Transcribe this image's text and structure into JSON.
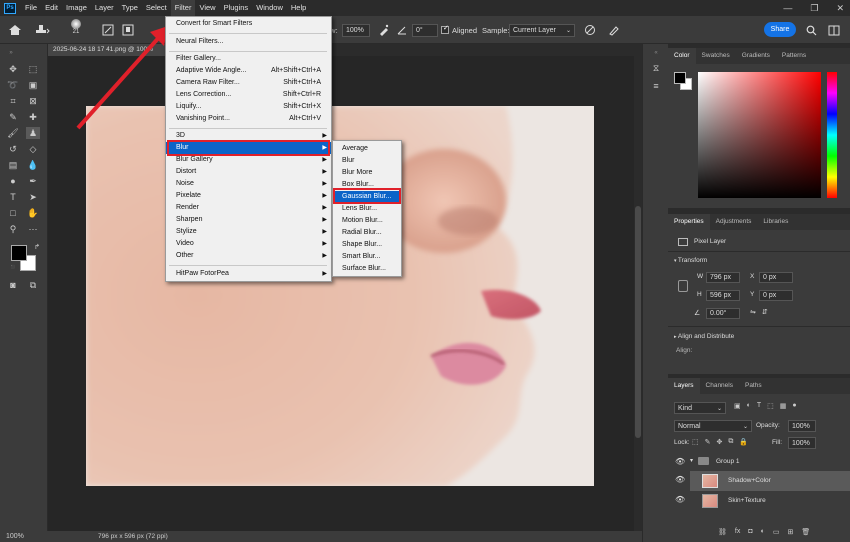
{
  "menubar": {
    "logo": "Ps",
    "items": [
      "File",
      "Edit",
      "Image",
      "Layer",
      "Type",
      "Select",
      "Filter",
      "View",
      "Plugins",
      "Window",
      "Help"
    ],
    "active_index": 6,
    "window_controls": [
      "—",
      "❐",
      "✕"
    ]
  },
  "options": {
    "brush_size": "21",
    "mode_label": "ow:",
    "flow_value": "100%",
    "angle_value": "0°",
    "aligned_label": "Aligned",
    "sample_label": "Sample:",
    "sample_value": "Current Layer",
    "share_label": "Share"
  },
  "document": {
    "tab_title": "2025-06-24 18 17 41.png @ 100%",
    "zoom": "100%",
    "status": "796 px x 596 px (72 ppi)"
  },
  "filter_menu": {
    "items": [
      {
        "label": "Convert for Smart Filters",
        "shortcut": "",
        "submenu": false
      },
      {
        "label": "Neural Filters...",
        "shortcut": "",
        "submenu": false
      },
      {
        "label": "Filter Gallery...",
        "shortcut": "",
        "submenu": false
      },
      {
        "label": "Adaptive Wide Angle...",
        "shortcut": "Alt+Shift+Ctrl+A",
        "submenu": false
      },
      {
        "label": "Camera Raw Filter...",
        "shortcut": "Shift+Ctrl+A",
        "submenu": false
      },
      {
        "label": "Lens Correction...",
        "shortcut": "Shift+Ctrl+R",
        "submenu": false
      },
      {
        "label": "Liquify...",
        "shortcut": "Shift+Ctrl+X",
        "submenu": false
      },
      {
        "label": "Vanishing Point...",
        "shortcut": "Alt+Ctrl+V",
        "submenu": false
      },
      {
        "label": "3D",
        "shortcut": "",
        "submenu": true
      },
      {
        "label": "Blur",
        "shortcut": "",
        "submenu": true
      },
      {
        "label": "Blur Gallery",
        "shortcut": "",
        "submenu": true
      },
      {
        "label": "Distort",
        "shortcut": "",
        "submenu": true
      },
      {
        "label": "Noise",
        "shortcut": "",
        "submenu": true
      },
      {
        "label": "Pixelate",
        "shortcut": "",
        "submenu": true
      },
      {
        "label": "Render",
        "shortcut": "",
        "submenu": true
      },
      {
        "label": "Sharpen",
        "shortcut": "",
        "submenu": true
      },
      {
        "label": "Stylize",
        "shortcut": "",
        "submenu": true
      },
      {
        "label": "Video",
        "shortcut": "",
        "submenu": true
      },
      {
        "label": "Other",
        "shortcut": "",
        "submenu": true
      },
      {
        "label": "HitPaw FotorPea",
        "shortcut": "",
        "submenu": true
      }
    ],
    "highlighted": "Blur"
  },
  "blur_menu": {
    "items": [
      "Average",
      "Blur",
      "Blur More",
      "Box Blur...",
      "Gaussian Blur...",
      "Lens Blur...",
      "Motion Blur...",
      "Radial Blur...",
      "Shape Blur...",
      "Smart Blur...",
      "Surface Blur..."
    ],
    "highlighted": "Gaussian Blur..."
  },
  "color_panel": {
    "tabs": [
      "Color",
      "Swatches",
      "Gradients",
      "Patterns"
    ],
    "active": "Color"
  },
  "properties_panel": {
    "tabs": [
      "Properties",
      "Adjustments",
      "Libraries"
    ],
    "active": "Properties",
    "layer_kind": "Pixel Layer",
    "transform_title": "Transform",
    "w_label": "W",
    "w_value": "796 px",
    "h_label": "H",
    "h_value": "596 px",
    "x_label": "X",
    "x_value": "0 px",
    "y_label": "Y",
    "y_value": "0 px",
    "angle_value": "0.00°",
    "align_title": "Align and Distribute",
    "align_label": "Align:"
  },
  "layers_panel": {
    "tabs": [
      "Layers",
      "Channels",
      "Paths"
    ],
    "active": "Layers",
    "kind_label": "Kind",
    "blend_mode": "Normal",
    "opacity_label": "Opacity:",
    "opacity_value": "100%",
    "lock_label": "Lock:",
    "fill_label": "Fill:",
    "fill_value": "100%",
    "layers": [
      {
        "name": "Group 1",
        "type": "group"
      },
      {
        "name": "Shadow+Color",
        "type": "pixel",
        "selected": true
      },
      {
        "name": "Skin+Texture",
        "type": "pixel",
        "selected": false
      }
    ]
  },
  "colors": {
    "accent_red": "#e0202a",
    "menu_highlight": "#0c64c8",
    "share_blue": "#1473e6"
  }
}
